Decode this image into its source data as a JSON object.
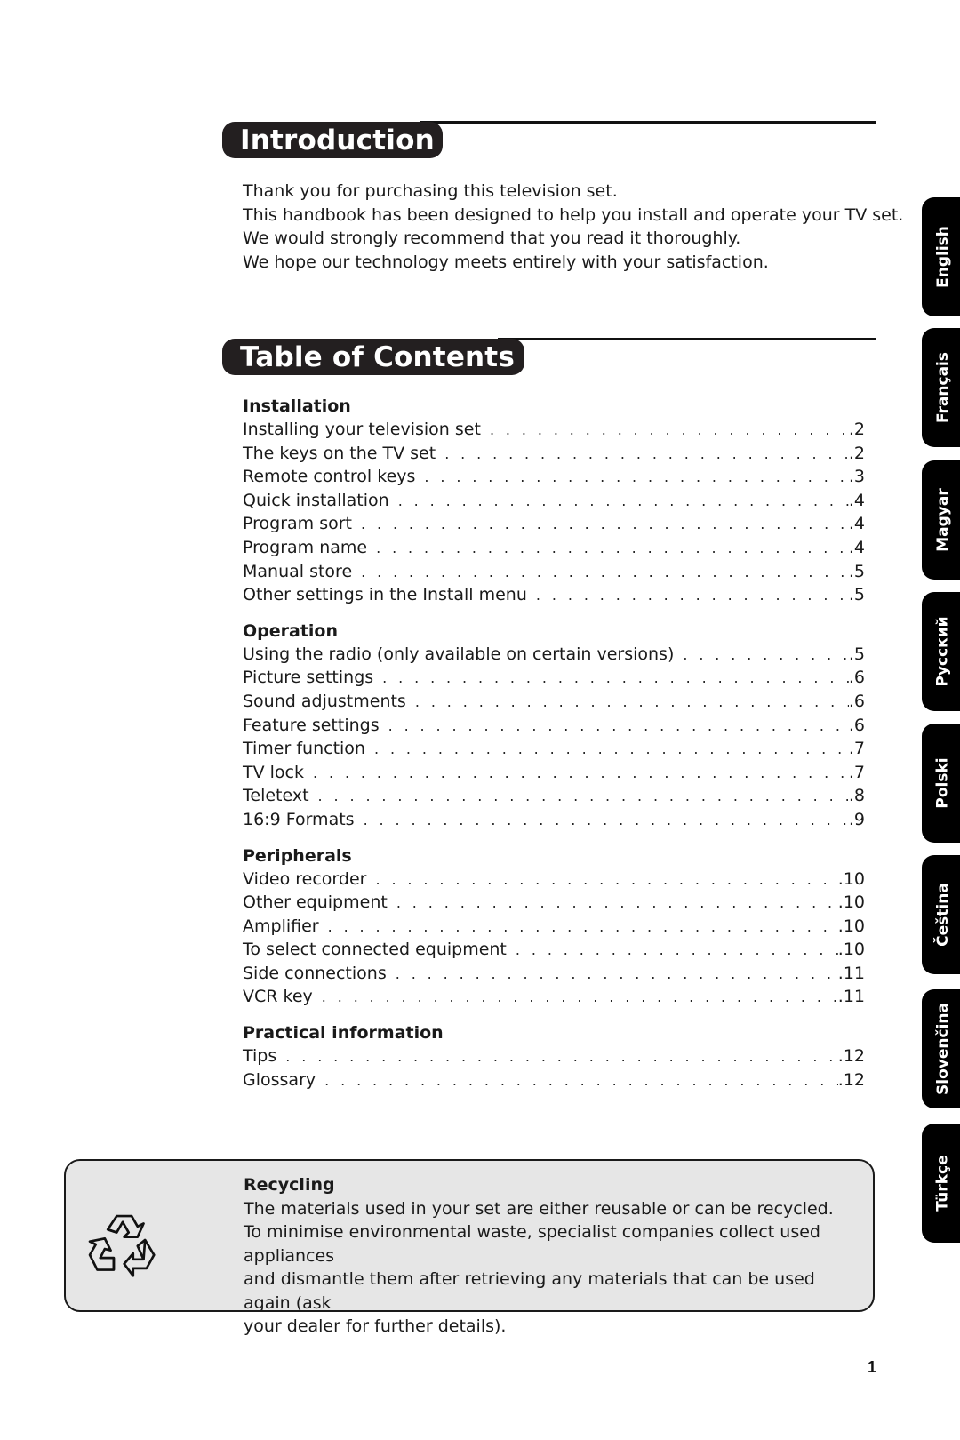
{
  "intro": {
    "title": "Introduction",
    "lines": [
      "Thank you for purchasing this television set.",
      "This handbook has been designed to help you install and operate your TV set.",
      "We would strongly recommend that you read it thoroughly.",
      "We hope our technology meets entirely with your satisfaction."
    ]
  },
  "toc": {
    "title": "Table of Contents",
    "sections": [
      {
        "heading": "Installation",
        "items": [
          {
            "label": "Installing your television set",
            "page": "2"
          },
          {
            "label": "The keys on the TV set",
            "page": "2"
          },
          {
            "label": "Remote control keys",
            "page": "3"
          },
          {
            "label": "Quick installation",
            "page": "4"
          },
          {
            "label": "Program sort",
            "page": "4"
          },
          {
            "label": "Program name",
            "page": "4"
          },
          {
            "label": "Manual store",
            "page": "5"
          },
          {
            "label": "Other settings in the Install menu",
            "page": "5"
          }
        ]
      },
      {
        "heading": "Operation",
        "items": [
          {
            "label": "Using the radio (only available on certain versions)",
            "page": "5"
          },
          {
            "label": "Picture settings",
            "page": "6"
          },
          {
            "label": "Sound adjustments",
            "page": "6"
          },
          {
            "label": "Feature settings",
            "page": "6"
          },
          {
            "label": "Timer function",
            "page": "7"
          },
          {
            "label": "TV lock",
            "page": "7"
          },
          {
            "label": "Teletext",
            "page": "8"
          },
          {
            "label": "16:9 Formats",
            "page": "9"
          }
        ]
      },
      {
        "heading": "Peripherals",
        "items": [
          {
            "label": "Video recorder",
            "page": "10"
          },
          {
            "label": "Other equipment",
            "page": "10"
          },
          {
            "label": "Amplifier",
            "page": "10"
          },
          {
            "label": "To select connected equipment",
            "page": "10"
          },
          {
            "label": "Side connections",
            "page": "11"
          },
          {
            "label": "VCR key",
            "page": "11"
          }
        ]
      },
      {
        "heading": "Practical information",
        "items": [
          {
            "label": "Tips",
            "page": "12"
          },
          {
            "label": "Glossary",
            "page": "12"
          }
        ]
      }
    ]
  },
  "language_tabs": [
    "English",
    "Français",
    "Magyar",
    "Русский",
    "Polski",
    "Čeština",
    "Slovenčina",
    "Türkçe"
  ],
  "recycling": {
    "icon": "recycle-icon",
    "title": "Recycling",
    "lines": [
      "The materials used in your set are either reusable or can be recycled.",
      "To minimise environmental waste, specialist companies collect used appliances",
      "and dismantle them after retrieving any materials that can be used again (ask",
      "your dealer for further details)."
    ]
  },
  "page_number": "1"
}
